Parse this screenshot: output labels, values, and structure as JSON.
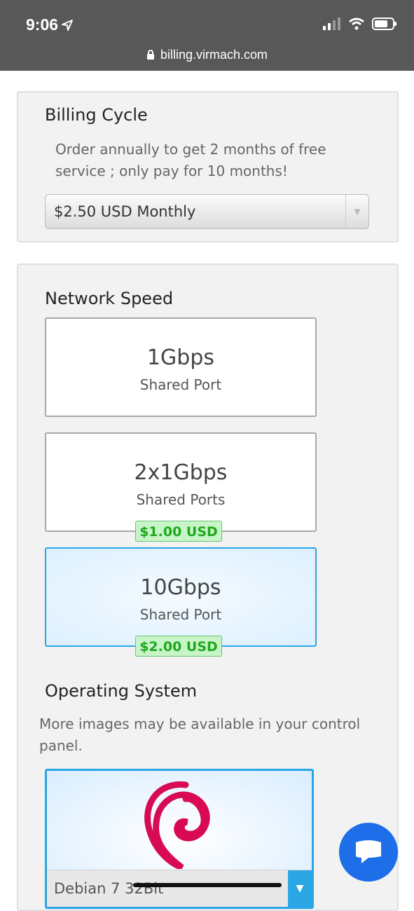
{
  "status": {
    "time": "9:06",
    "url": "billing.virmach.com"
  },
  "billing": {
    "title": "Billing Cycle",
    "description": "Order annually to get 2 months of free service ; only pay for 10 months!",
    "selected": "$2.50 USD Monthly"
  },
  "network": {
    "title": "Network Speed",
    "options": [
      {
        "speed": "1Gbps",
        "port": "Shared Port",
        "price": ""
      },
      {
        "speed": "2x1Gbps",
        "port": "Shared Ports",
        "price": "$1.00 USD"
      },
      {
        "speed": "10Gbps",
        "port": "Shared Port",
        "price": "$2.00 USD"
      }
    ]
  },
  "os": {
    "title": "Operating System",
    "description": "More images may be available in your control panel.",
    "selected": "Debian 7 32Bit"
  },
  "colors": {
    "accent": "#2ba6e5",
    "badge_green": "#1fa81f",
    "chat_blue": "#1d6ee8"
  },
  "icons": [
    "location-arrow-icon",
    "signal-icon",
    "wifi-icon",
    "battery-icon",
    "lock-icon",
    "debian-logo-icon",
    "chat-icon",
    "chevron-down-icon"
  ]
}
